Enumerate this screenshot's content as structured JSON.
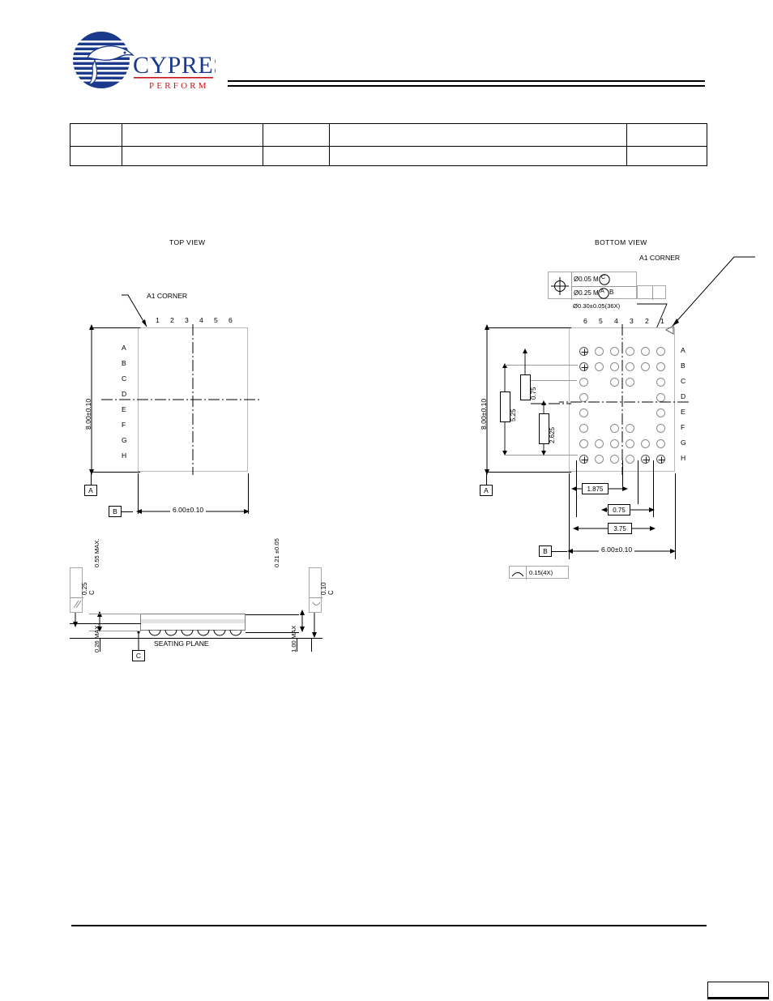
{
  "brand": {
    "name": "CYPRESS",
    "tagline": "PERFORM",
    "logo_blue": "#1b3a8c",
    "logo_red": "#c4161c"
  },
  "spec_table": {
    "rows": [
      {
        "cells": [
          "",
          "",
          "",
          "",
          ""
        ]
      },
      {
        "cells": [
          "",
          "",
          "",
          "",
          ""
        ]
      }
    ]
  },
  "top_view": {
    "title": "TOP VIEW",
    "a1_corner_label": "A1 CORNER",
    "columns": [
      "1",
      "2",
      "3",
      "4",
      "5",
      "6"
    ],
    "rows": [
      "A",
      "B",
      "C",
      "D",
      "E",
      "F",
      "G",
      "H"
    ],
    "dim_vertical": "8.00±0.10",
    "dim_horizontal": "6.00±0.10",
    "datum_a": "A",
    "datum_b": "B"
  },
  "bottom_view": {
    "title": "BOTTOM VIEW",
    "a1_corner_label": "A1 CORNER",
    "columns": [
      "6",
      "5",
      "4",
      "3",
      "2",
      "1"
    ],
    "rows": [
      "A",
      "B",
      "C",
      "D",
      "E",
      "F",
      "G",
      "H"
    ],
    "fcf": {
      "row1": "Ø0.05 M",
      "row1_datum": "C",
      "row2": "Ø0.25 M",
      "row2_datum_a": "A",
      "row2_datum_b": "B"
    },
    "ball_dia_note": "Ø0.30±0.05(36X)",
    "dim_vertical": "8.00±0.10",
    "dim_horizontal": "6.00±0.10",
    "dim_5_25": "5.25",
    "dim_0_75_v": "0.75",
    "dim_2_625": "2.625",
    "dim_1_875": "1.875",
    "dim_0_75_h": "0.75",
    "dim_3_75": "3.75",
    "datum_a": "A",
    "datum_b": "B",
    "profile_note": "0.15(4X)",
    "ball_matrix": [
      {
        "row": "A",
        "balls": [
          1,
          1,
          1,
          1,
          1,
          1
        ]
      },
      {
        "row": "B",
        "balls": [
          1,
          1,
          1,
          1,
          1,
          1
        ]
      },
      {
        "row": "C",
        "balls": [
          1,
          0,
          1,
          1,
          0,
          1
        ]
      },
      {
        "row": "D",
        "balls": [
          1,
          0,
          0,
          0,
          0,
          1
        ]
      },
      {
        "row": "E",
        "balls": [
          1,
          0,
          0,
          0,
          0,
          1
        ]
      },
      {
        "row": "F",
        "balls": [
          1,
          0,
          1,
          1,
          0,
          1
        ]
      },
      {
        "row": "G",
        "balls": [
          1,
          1,
          1,
          1,
          1,
          1
        ]
      },
      {
        "row": "H",
        "balls": [
          1,
          1,
          1,
          1,
          1,
          1
        ]
      }
    ],
    "marked_balls": [
      "A6",
      "B6",
      "H6",
      "H2",
      "H1"
    ]
  },
  "side_view": {
    "parallelism_note": "0.25 C",
    "dim_0_55": "0.55 MAX.",
    "dim_0_26": "0.26 MAX.",
    "seating_plane_label": "SEATING PLANE",
    "datum_c": "C",
    "dim_0_21": "0.21 ±0.05",
    "flatness_note": "0.10 C",
    "dim_1_00": "1.00 MAX",
    "ball_count": 6
  }
}
